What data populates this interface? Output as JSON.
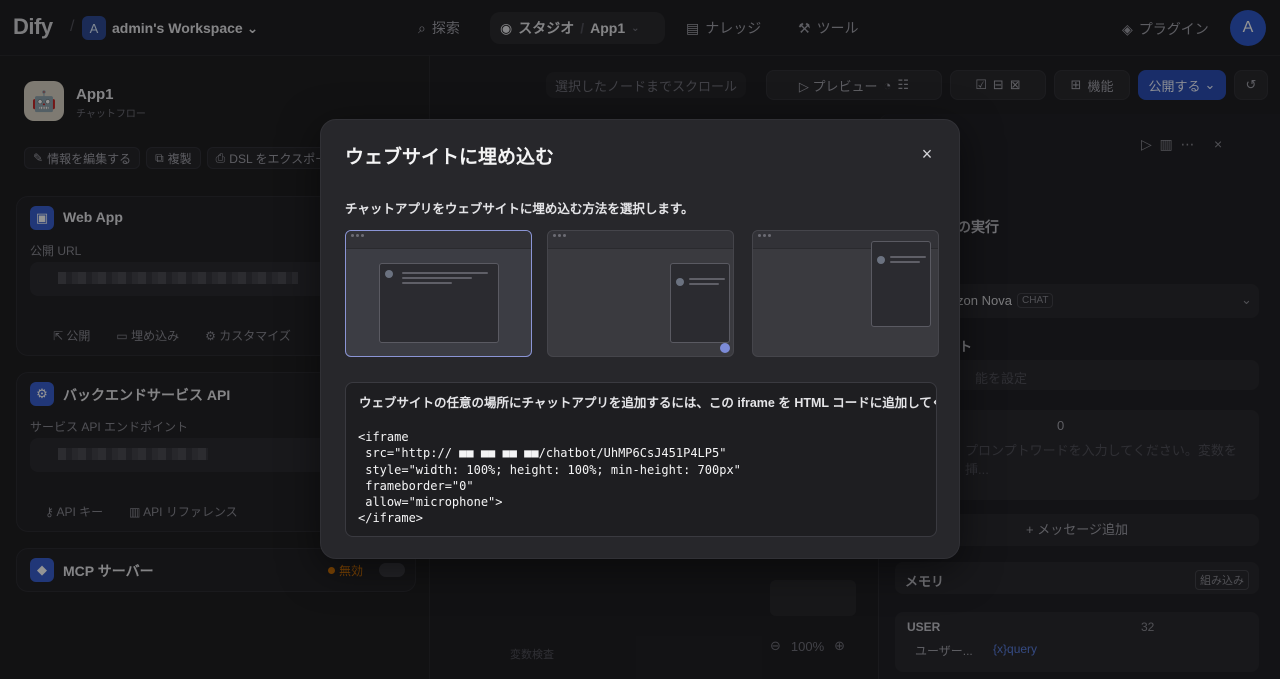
{
  "topbar": {
    "logo": "Dify",
    "workspace_initial": "A",
    "workspace_name": "admin's Workspace",
    "nav": {
      "explore": "探索",
      "studio": "スタジオ",
      "app": "App1",
      "knowledge": "ナレッジ",
      "tools": "ツール"
    },
    "plugins": "プラグイン",
    "user_initial": "A"
  },
  "left_panel": {
    "app_name": "App1",
    "app_type": "チャットフロー",
    "actions": [
      "情報を編集する",
      "複製",
      "DSL をエクスポート"
    ],
    "web_app": {
      "title": "Web App",
      "url_label": "公開 URL",
      "links": [
        "公開",
        "埋め込み",
        "カスタマイズ"
      ]
    },
    "backend_api": {
      "title": "バックエンドサービス API",
      "endpoint_label": "サービス API エンドポイント",
      "links": [
        "API キー",
        "API リファレンス"
      ]
    },
    "mcp": {
      "title": "MCP サーバー",
      "status": "無効"
    }
  },
  "canvas": {
    "scroll_hint": "選択したノードまでスクロール",
    "preview": "プレビュー",
    "features": "機能",
    "publish": "公開する",
    "zoom": "100%",
    "var_inspect": "変数検査"
  },
  "debug_panel": {
    "run_title": "の実行",
    "model": "zon Nova",
    "model_badge": "CHAT",
    "prompt_section": "ト",
    "prompt_placeholder": "プロンプトワードを入力してください。変数を挿...",
    "system_placeholder": "能を設定",
    "add_message": "+ メッセージ追加",
    "memory": "メモリ",
    "memory_builtin": "組み込み",
    "user_label": "USER",
    "user_count": "32",
    "user_chip": "ユーザー...",
    "query_chip": "{x}query",
    "count_zero": "0"
  },
  "modal": {
    "title": "ウェブサイトに埋め込む",
    "subtitle": "チャットアプリをウェブサイトに埋め込む方法を選択します。",
    "code_description": "ウェブサイトの任意の場所にチャットアプリを追加するには、この iframe を HTML コードに追加してく",
    "code": "<iframe\n src=\"http:// ■■ ■■ ■■ ■■/chatbot/UhMP6CsJ451P4LP5\"\n style=\"width: 100%; height: 100%; min-height: 700px\"\n frameborder=\"0\"\n allow=\"microphone\">\n</iframe>",
    "close_icon": "×"
  },
  "colors": {
    "accent": "#2b4fb5",
    "selected_border": "#8b95d6",
    "warning": "#d97706"
  }
}
